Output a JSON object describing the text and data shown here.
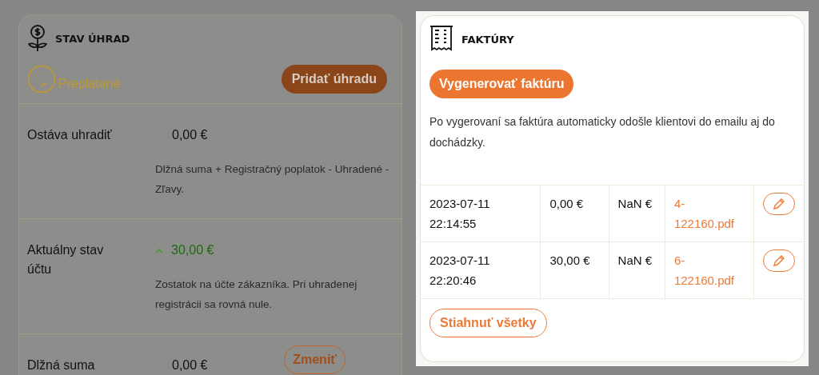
{
  "payment_status": {
    "title": "STAV ÚHRAD",
    "status": "Preplatené",
    "add_button": "Pridať úhradu",
    "rows": [
      {
        "label": "Ostáva uhradiť",
        "value": "0,00 €",
        "rising": false,
        "description": "Dlžná suma + Registračný poplatok - Uhradené - Zľavy."
      },
      {
        "label": "Aktuálny stav účtu",
        "value": "30,00 €",
        "rising": true,
        "description": "Zostatok na účte zákazníka. Pri uhradenej registrácii sa rovná nule."
      },
      {
        "label": "Dlžná suma",
        "value": "0,00 €",
        "rising": false,
        "button": "Zmeniť"
      }
    ]
  },
  "invoices": {
    "title": "FAKTÚRY",
    "generate_button": "Vygenerovať faktúru",
    "note": "Po vygerovaní sa faktúra automaticky odošle klientovi do emailu aj do dochádzky.",
    "rows": [
      {
        "created": "2023-07-11 22:14:55",
        "amount": "0,00 €",
        "column_3": "NaN €",
        "file": "4-122160.pdf"
      },
      {
        "created": "2023-07-11 22:20:46",
        "amount": "30,00 €",
        "column_3": "NaN €",
        "file": "6-122160.pdf"
      }
    ],
    "download_all_button": "Stiahnuť všetky"
  }
}
